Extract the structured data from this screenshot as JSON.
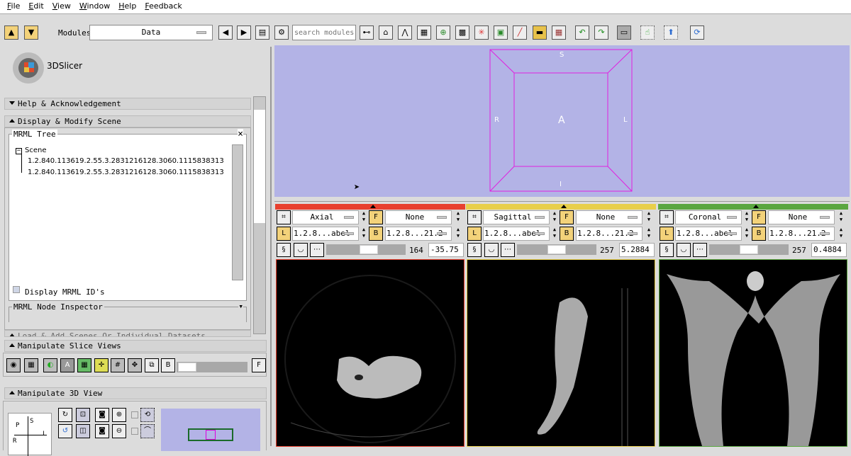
{
  "menu": [
    "File",
    "Edit",
    "View",
    "Window",
    "Help",
    "Feedback"
  ],
  "toolbar": {
    "modules_label": "Modules",
    "module_value": "Data",
    "search_placeholder": "search modules"
  },
  "logo": {
    "text": "3DSlicer"
  },
  "left": {
    "sections": {
      "help": "Help & Acknowledgement",
      "display": "Display & Modify Scene",
      "load": "Load & Add Scenes Or Individual Datasets",
      "slice": "Manipulate Slice Views",
      "view3d": "Manipulate 3D View"
    },
    "mrml_tree": {
      "title": "MRML Tree",
      "close": "×",
      "root": "Scene",
      "items": [
        "1.2.840.113619.2.55.3.2831216128.3060.1115838313",
        "1.2.840.113619.2.55.3.2831216128.3060.1115838313"
      ],
      "display_ids_label": "Display MRML ID's"
    },
    "node_inspector": "MRML Node Inspector",
    "orientation": {
      "p": "P",
      "s": "S",
      "l": "L",
      "r": "R"
    }
  },
  "view3d": {
    "labels": {
      "s": "S",
      "i": "I",
      "r": "R",
      "l": "L",
      "a": "A"
    }
  },
  "slices": [
    {
      "name": "Axial",
      "color": "#e8402e",
      "foreground": "None",
      "label": "1.2.8...abel",
      "background": "1.2.8...21.2",
      "slice_index": "164",
      "offset": "-35.75",
      "slider": 0.55
    },
    {
      "name": "Sagittal",
      "color": "#e8cf4a",
      "foreground": "None",
      "label": "1.2.8...abel",
      "background": "1.2.8...21.2",
      "slice_index": "257",
      "offset": "5.2884",
      "slider": 0.5
    },
    {
      "name": "Coronal",
      "color": "#5aa640",
      "foreground": "None",
      "label": "1.2.8...abel",
      "background": "1.2.8...21.2",
      "slice_index": "257",
      "offset": "0.4884",
      "slider": 0.5
    }
  ]
}
